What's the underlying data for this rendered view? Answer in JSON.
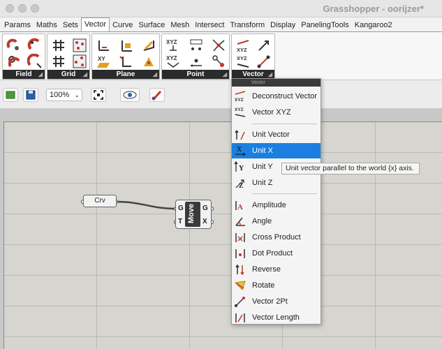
{
  "window": {
    "title": "Grasshopper - oorijzer*"
  },
  "menu_tabs": [
    "Params",
    "Maths",
    "Sets",
    "Vector",
    "Curve",
    "Surface",
    "Mesh",
    "Intersect",
    "Transform",
    "Display",
    "PanelingTools",
    "Kangaroo2"
  ],
  "active_tab": "Vector",
  "ribbon_panels": [
    "Field",
    "Grid",
    "Plane",
    "Point",
    "Vector"
  ],
  "toolbar": {
    "zoom": "100%"
  },
  "canvas": {
    "crv_label": "Crv",
    "move": {
      "name": "Move",
      "in_g": "G",
      "in_t": "T",
      "out_g": "G",
      "out_x": "X"
    }
  },
  "popup": {
    "header": "Vector",
    "items": [
      "Deconstruct Vector",
      "Vector XYZ",
      "Unit Vector",
      "Unit X",
      "Unit Y",
      "Unit Z",
      "Amplitude",
      "Angle",
      "Cross Product",
      "Dot Product",
      "Reverse",
      "Rotate",
      "Vector 2Pt",
      "Vector Length"
    ],
    "selected": "Unit X"
  },
  "tooltip": "Unit vector parallel to the world {x} axis.",
  "colors": {
    "selection": "#1a7fe0",
    "panel_caption": "#2b2b2b",
    "canvas": "#d6d5cf"
  }
}
